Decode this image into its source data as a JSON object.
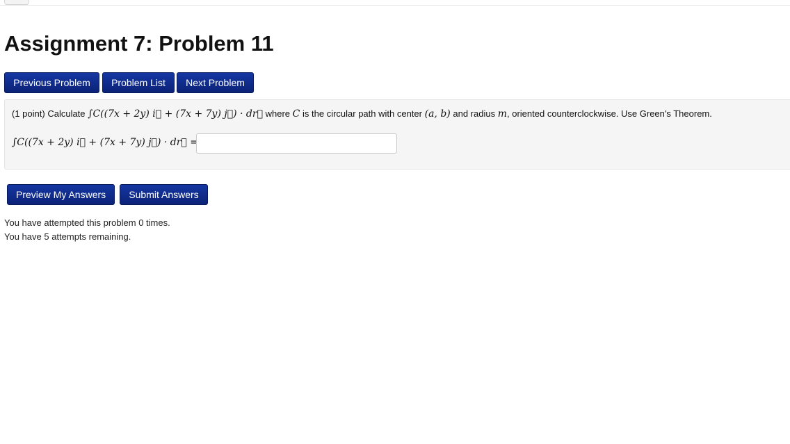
{
  "page": {
    "title": "Assignment 7: Problem 11"
  },
  "nav": {
    "previous_label": "Previous Problem",
    "list_label": "Problem List",
    "next_label": "Next Problem"
  },
  "problem": {
    "points": "(1 point)",
    "calculate_word": "Calculate",
    "integrand": "∫C((7x + 2y) i⃗ + (7x + 7y) j⃗) · dr⃗",
    "where_text": "where",
    "curve_symbol": "C",
    "path_text": "is the circular path with center",
    "center": "(a, b)",
    "radius_text": "and radius",
    "radius_symbol": "m",
    "rest_text": ", oriented counterclockwise. Use Green's Theorem.",
    "answer_label": "∫C((7x + 2y) i⃗ + (7x + 7y) j⃗) · dr⃗ =",
    "answer_value": ""
  },
  "actions": {
    "preview_label": "Preview My Answers",
    "submit_label": "Submit Answers"
  },
  "attempts": {
    "attempted_text": "You have attempted this problem 0 times.",
    "remaining_text": "You have 5 attempts remaining."
  }
}
